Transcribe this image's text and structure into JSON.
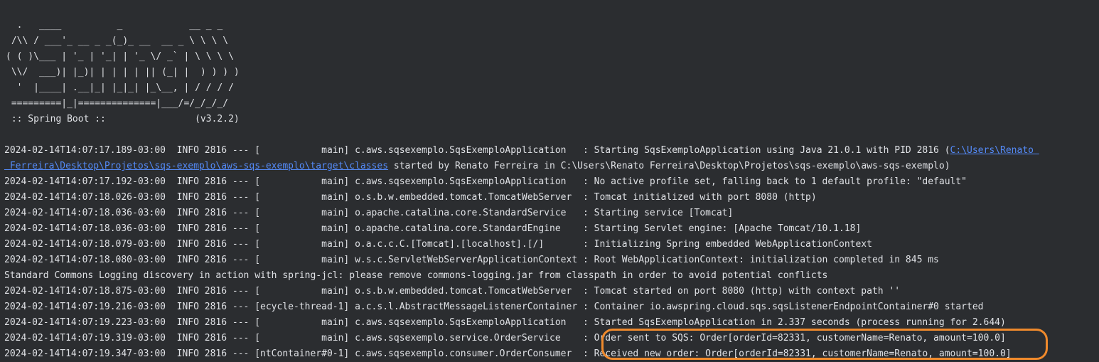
{
  "banner": [
    "  .   ____          _            __ _ _",
    " /\\\\ / ___'_ __ _ _(_)_ __  __ _ \\ \\ \\ \\",
    "( ( )\\___ | '_ | '_| | '_ \\/ _` | \\ \\ \\ \\",
    " \\\\/  ___)| |_)| | | | | || (_| |  ) ) ) )",
    "  '  |____| .__|_| |_|_| |_\\__, | / / / /",
    " =========|_|==============|___/=/_/_/_/",
    " :: Spring Boot ::                (v3.2.2)"
  ],
  "log": {
    "line1_prefix": "2024-02-14T14:07:17.189-03:00  INFO 2816 --- [           main] c.aws.sqsexemplo.SqsExemploApplication   : Starting SqsExemploApplication using Java 21.0.1 with PID 2816 (",
    "line1_link": "C:\\Users\\Renato ",
    "line2_link": " Ferreira\\Desktop\\Projetos\\sqs-exemplo\\aws-sqs-exemplo\\target\\classes",
    "line2_suffix": " started by Renato Ferreira in C:\\Users\\Renato Ferreira\\Desktop\\Projetos\\sqs-exemplo\\aws-sqs-exemplo)",
    "lines": [
      "2024-02-14T14:07:17.192-03:00  INFO 2816 --- [           main] c.aws.sqsexemplo.SqsExemploApplication   : No active profile set, falling back to 1 default profile: \"default\"",
      "2024-02-14T14:07:18.026-03:00  INFO 2816 --- [           main] o.s.b.w.embedded.tomcat.TomcatWebServer  : Tomcat initialized with port 8080 (http)",
      "2024-02-14T14:07:18.036-03:00  INFO 2816 --- [           main] o.apache.catalina.core.StandardService   : Starting service [Tomcat]",
      "2024-02-14T14:07:18.036-03:00  INFO 2816 --- [           main] o.apache.catalina.core.StandardEngine    : Starting Servlet engine: [Apache Tomcat/10.1.18]",
      "2024-02-14T14:07:18.079-03:00  INFO 2816 --- [           main] o.a.c.c.C.[Tomcat].[localhost].[/]       : Initializing Spring embedded WebApplicationContext",
      "2024-02-14T14:07:18.080-03:00  INFO 2816 --- [           main] w.s.c.ServletWebServerApplicationContext : Root WebApplicationContext: initialization completed in 845 ms",
      "Standard Commons Logging discovery in action with spring-jcl: please remove commons-logging.jar from classpath in order to avoid potential conflicts",
      "2024-02-14T14:07:18.875-03:00  INFO 2816 --- [           main] o.s.b.w.embedded.tomcat.TomcatWebServer  : Tomcat started on port 8080 (http) with context path ''",
      "2024-02-14T14:07:19.216-03:00  INFO 2816 --- [ecycle-thread-1] a.c.s.l.AbstractMessageListenerContainer : Container io.awspring.cloud.sqs.sqsListenerEndpointContainer#0 started",
      "2024-02-14T14:07:19.223-03:00  INFO 2816 --- [           main] c.aws.sqsexemplo.SqsExemploApplication   : Started SqsExemploApplication in 2.337 seconds (process running for 2.644)",
      "2024-02-14T14:07:19.319-03:00  INFO 2816 --- [           main] c.aws.sqsexemplo.service.OrderService    : Order sent to SQS: Order[orderId=82331, customerName=Renato, amount=100.0]",
      "2024-02-14T14:07:19.347-03:00  INFO 2816 --- [ntContainer#0-1] c.aws.sqsexemplo.consumer.OrderConsumer  : Received new order: Order[orderId=82331, customerName=Renato, amount=100.0]"
    ]
  },
  "colors": {
    "background": "#2b2d30",
    "text": "#dfe1e5",
    "link": "#548af7",
    "highlight": "#f08a2c"
  }
}
